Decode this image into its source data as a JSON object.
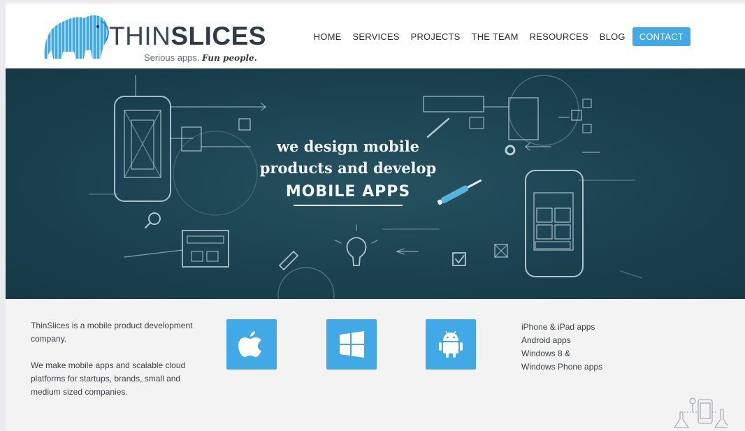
{
  "brand": {
    "name_thin": "THIN",
    "name_bold": "SLICES",
    "tagline_text": "Serious apps.",
    "tagline_fun": "Fun people.",
    "logo_color": "#3fa9e4"
  },
  "nav": {
    "items": [
      {
        "label": "HOME"
      },
      {
        "label": "SERVICES"
      },
      {
        "label": "PROJECTS"
      },
      {
        "label": "THE TEAM"
      },
      {
        "label": "RESOURCES"
      },
      {
        "label": "BLOG"
      },
      {
        "label": "CONTACT",
        "active": true
      }
    ],
    "accent": "#41a9e6"
  },
  "hero": {
    "line1": "we design mobile",
    "line2": "products and develop",
    "line3": "MOBILE APPS",
    "background": "#1b4250"
  },
  "about": {
    "p1": "ThinSlices is a mobile product development company.",
    "p2": "We make mobile apps and scalable cloud platforms for startups, brands, small and medium sized companies."
  },
  "platforms": [
    {
      "icon": "apple-icon"
    },
    {
      "icon": "windows-icon"
    },
    {
      "icon": "android-icon"
    }
  ],
  "apps_list": [
    "iPhone & iPad apps",
    "Android apps",
    "Windows 8 &",
    "Windows Phone apps"
  ]
}
